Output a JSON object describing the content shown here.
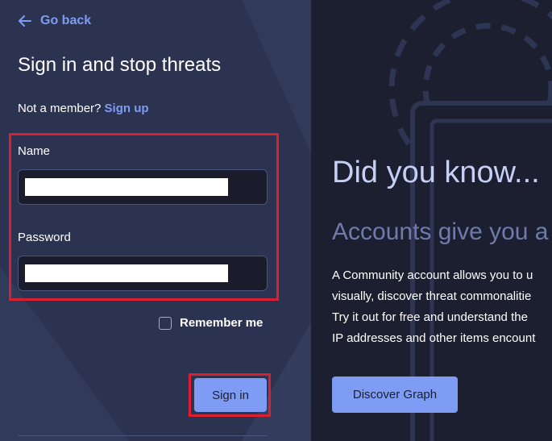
{
  "nav": {
    "go_back": "Go back"
  },
  "form": {
    "title": "Sign in and stop threats",
    "not_member": "Not a member?",
    "sign_up": "Sign up",
    "name_label": "Name",
    "password_label": "Password",
    "remember_me": "Remember me",
    "remember_checked": false,
    "sign_in": "Sign in"
  },
  "promo": {
    "heading": "Did you know...",
    "subheading": "Accounts give you a",
    "description_lines": [
      "A Community account allows you to u",
      "visually, discover threat commonalitie",
      "Try it out for free and understand the",
      "IP addresses and other items encount"
    ],
    "button": "Discover Graph"
  },
  "colors": {
    "accent": "#7f9cf5",
    "left_panel": "#2c3350",
    "right_panel": "#1c1f30",
    "highlight": "#d9202e"
  }
}
